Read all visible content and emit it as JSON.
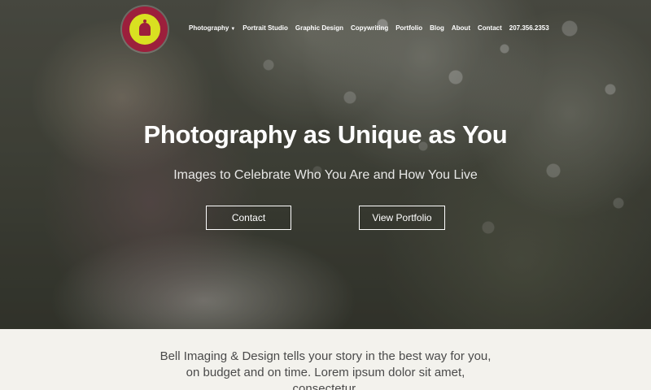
{
  "brand": {
    "logo_icon": "bell-logo-icon",
    "colors": {
      "maroon": "#9c1f3c",
      "yellow": "#d9e021"
    }
  },
  "nav": {
    "items": [
      {
        "label": "Photography",
        "has_dropdown": true
      },
      {
        "label": "Portrait Studio"
      },
      {
        "label": "Graphic Design"
      },
      {
        "label": "Copywriting"
      },
      {
        "label": "Portfolio"
      },
      {
        "label": "Blog"
      },
      {
        "label": "About"
      },
      {
        "label": "Contact"
      },
      {
        "label": "207.356.2353"
      }
    ],
    "dropdown_icon": "caret-down-icon"
  },
  "hero": {
    "title": "Photography as Unique as You",
    "subtitle": "Images to Celebrate Who You Are and How You Live",
    "buttons": {
      "contact": "Contact",
      "portfolio": "View Portfolio"
    }
  },
  "intro": {
    "text": "Bell Imaging & Design tells your story in the best way for you, on budget and on time. Lorem ipsum dolor sit amet, consectetur."
  }
}
